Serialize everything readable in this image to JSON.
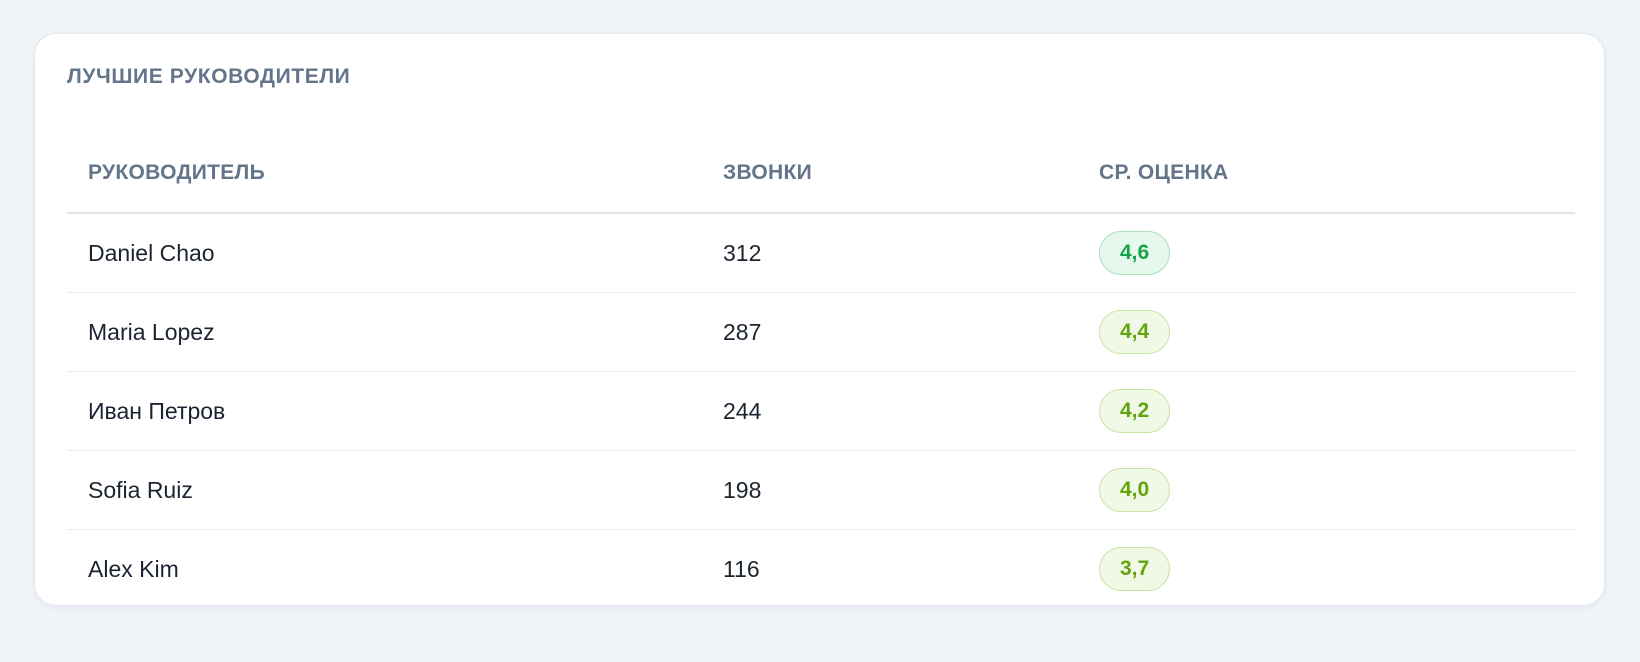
{
  "panel": {
    "title": "ЛУЧШИЕ РУКОВОДИТЕЛИ"
  },
  "table": {
    "headers": [
      "РУКОВОДИТЕЛЬ",
      "ЗВОНКИ",
      "СР. ОЦЕНКА"
    ],
    "rows": [
      {
        "name": "Daniel Chao",
        "calls": "312",
        "score": "4,6",
        "score_value": 4.6,
        "badge_text": "#16a34a",
        "badge_bg": "#e6f7ec",
        "badge_border": "#a7dfba"
      },
      {
        "name": "Maria Lopez",
        "calls": "287",
        "score": "4,4",
        "score_value": 4.4,
        "badge_text": "#65a30d",
        "badge_bg": "#f0f8e6",
        "badge_border": "#c6e3a4"
      },
      {
        "name": "Иван Петров",
        "calls": "244",
        "score": "4,2",
        "score_value": 4.2,
        "badge_text": "#65a30d",
        "badge_bg": "#f0f8e6",
        "badge_border": "#c6e3a4"
      },
      {
        "name": "Sofia Ruiz",
        "calls": "198",
        "score": "4,0",
        "score_value": 4.0,
        "badge_text": "#65a30d",
        "badge_bg": "#f0f8e6",
        "badge_border": "#c6e3a4"
      },
      {
        "name": "Alex Kim",
        "calls": "116",
        "score": "3,7",
        "score_value": 3.7,
        "badge_text": "#65a30d",
        "badge_bg": "#f0f8e6",
        "badge_border": "#c6e3a4"
      }
    ]
  }
}
